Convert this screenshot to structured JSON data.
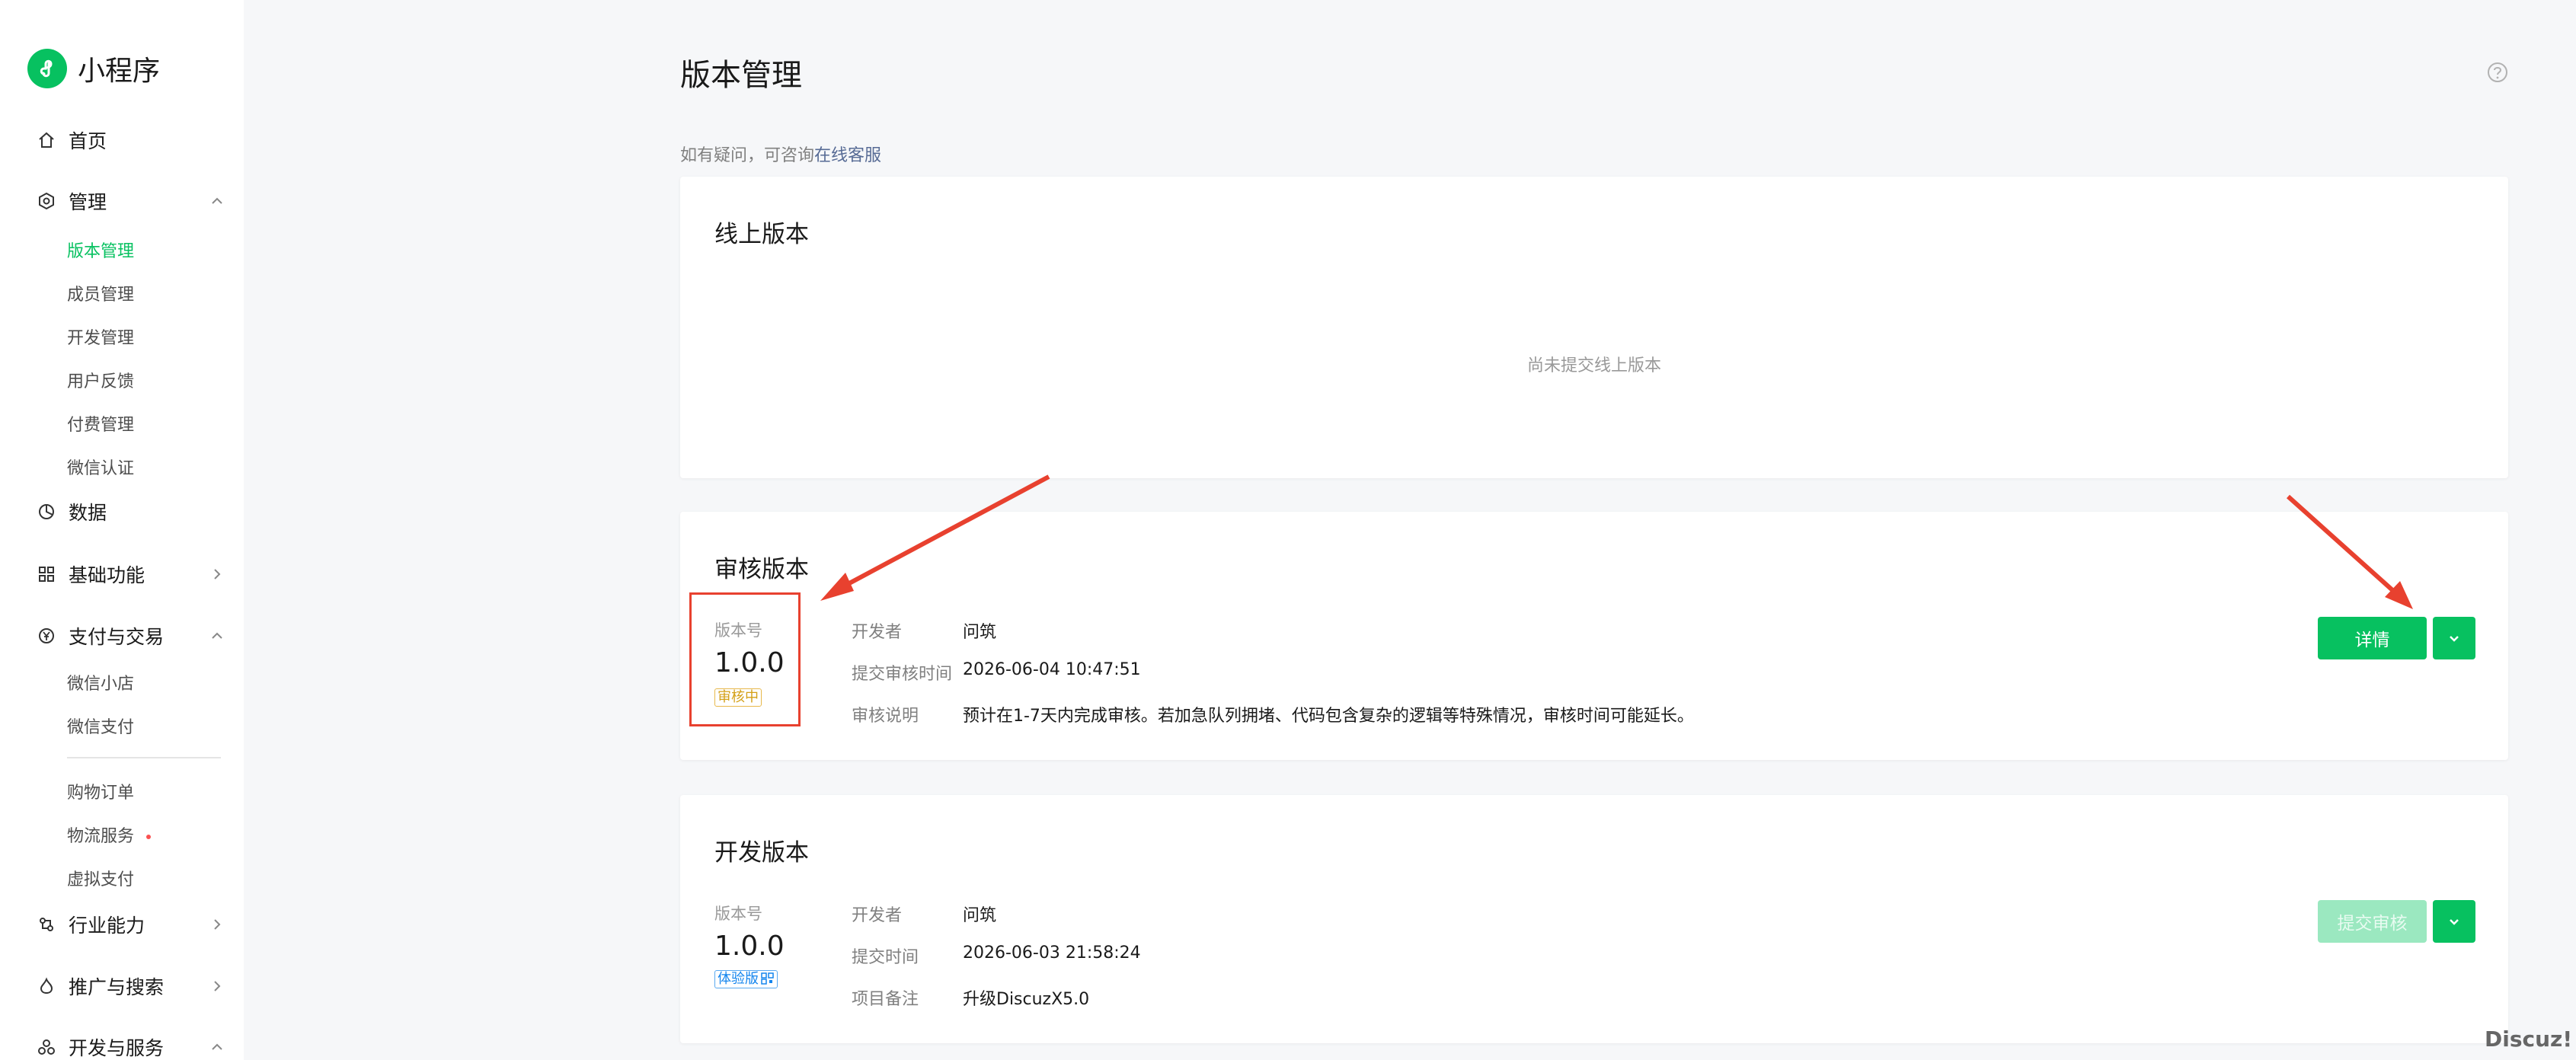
{
  "sidebar": {
    "logo_text": "小程序",
    "home": "首页",
    "manage": "管理",
    "manage_items": [
      "版本管理",
      "成员管理",
      "开发管理",
      "用户反馈",
      "付费管理",
      "微信认证"
    ],
    "data": "数据",
    "basic": "基础功能",
    "pay": "支付与交易",
    "pay_items": [
      "微信小店",
      "微信支付"
    ],
    "pay_items2": [
      "购物订单",
      "物流服务",
      "虚拟支付"
    ],
    "industry": "行业能力",
    "promote": "推广与搜索",
    "devservice": "开发与服务"
  },
  "page": {
    "title": "版本管理",
    "notice_prefix": "如有疑问，可咨询",
    "notice_link": "在线客服"
  },
  "online": {
    "title": "线上版本",
    "empty": "尚未提交线上版本"
  },
  "review": {
    "title": "审核版本",
    "version_label": "版本号",
    "version": "1.0.0",
    "status": "审核中",
    "k1": "开发者",
    "v1": "问筑",
    "k2": "提交审核时间",
    "v2": "2026-06-04 10:47:51",
    "k3": "审核说明",
    "v3": "预计在1-7天内完成审核。若加急队列拥堵、代码包含复杂的逻辑等特殊情况，审核时间可能延长。",
    "button": "详情"
  },
  "dev": {
    "title": "开发版本",
    "version_label": "版本号",
    "version": "1.0.0",
    "status": "体验版",
    "k1": "开发者",
    "v1": "问筑",
    "k2": "提交时间",
    "v2": "2026-06-03 21:58:24",
    "k3": "项目备注",
    "v3": "升级DiscuzX5.0",
    "button": "提交审核"
  },
  "watermark": "Discuz!",
  "colors": {
    "accent": "#07c160",
    "annotation": "#e8412f"
  }
}
